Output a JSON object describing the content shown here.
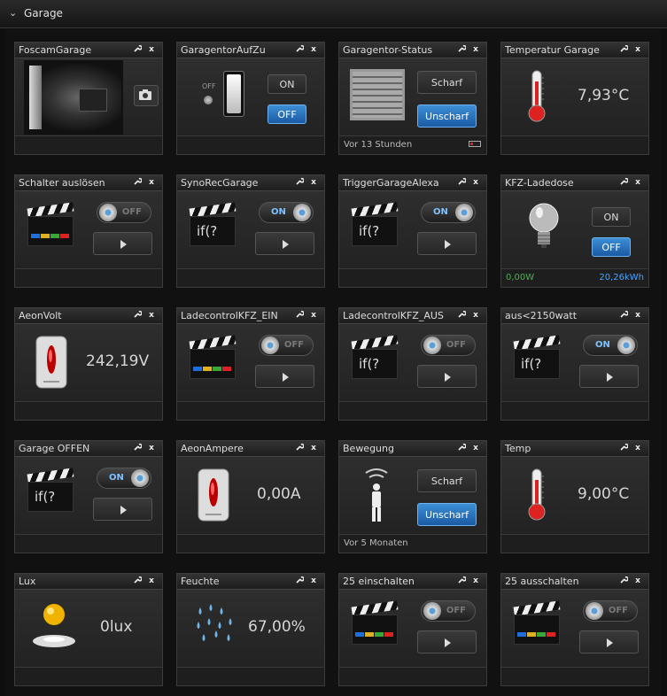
{
  "section": {
    "chevron": "⌄",
    "title": "Garage"
  },
  "icons": {
    "tool": "wrench-icon",
    "close": "close-icon"
  },
  "close_glyph": "x",
  "colors": {
    "blue_button": "#1a5aa3",
    "on_text": "#7fc1ff",
    "power_green": "#4caf50",
    "energy_blue": "#4aa3ff"
  },
  "widgets": [
    {
      "title": "FoscamGarage",
      "type": "camera"
    },
    {
      "title": "GaragentorAufZu",
      "type": "switch",
      "switch_label": "OFF",
      "on_label": "ON",
      "off_label": "OFF",
      "active": "off"
    },
    {
      "title": "Garagentor-Status",
      "type": "alarm",
      "arm_label": "Scharf",
      "disarm_label": "Unscharf",
      "active": "disarm",
      "footer": "Vor 13 Stunden"
    },
    {
      "title": "Temperatur Garage",
      "type": "temperature",
      "value": "7,93°C"
    },
    {
      "title": "Schalter auslösen",
      "type": "scene",
      "toggle": "OFF",
      "variant": "bars"
    },
    {
      "title": "SynoRecGarage",
      "type": "scene",
      "toggle": "ON",
      "variant": "if",
      "if_text": "if(?"
    },
    {
      "title": "TriggerGarageAlexa",
      "type": "scene",
      "toggle": "ON",
      "variant": "if",
      "if_text": "if(?"
    },
    {
      "title": "KFZ-Ladedose",
      "type": "plug",
      "on_label": "ON",
      "off_label": "OFF",
      "active": "off",
      "power": "0,00W",
      "energy": "20,26kWh"
    },
    {
      "title": "AeonVolt",
      "type": "meter",
      "value": "242,19V"
    },
    {
      "title": "LadecontrolKFZ_EIN",
      "type": "scene",
      "toggle": "OFF",
      "variant": "bars"
    },
    {
      "title": "LadecontrolKFZ_AUS",
      "type": "scene",
      "toggle": "OFF",
      "variant": "if",
      "if_text": "if(?"
    },
    {
      "title": "aus<2150watt",
      "type": "scene",
      "toggle": "ON",
      "variant": "if",
      "if_text": "if(?"
    },
    {
      "title": "Garage OFFEN",
      "type": "scene",
      "toggle": "ON",
      "variant": "if",
      "if_text": "if(?"
    },
    {
      "title": "AeonAmpere",
      "type": "meter",
      "value": "0,00A"
    },
    {
      "title": "Bewegung",
      "type": "motion",
      "arm_label": "Scharf",
      "disarm_label": "Unscharf",
      "active": "disarm",
      "footer": "Vor 5 Monaten"
    },
    {
      "title": "Temp",
      "type": "temperature",
      "value": "9,00°C"
    },
    {
      "title": "Lux",
      "type": "lux",
      "value": "0lux"
    },
    {
      "title": "Feuchte",
      "type": "humidity",
      "value": "67,00%"
    },
    {
      "title": "25 einschalten",
      "type": "scene",
      "toggle": "OFF",
      "variant": "bars"
    },
    {
      "title": "25 ausschalten",
      "type": "scene",
      "toggle": "OFF",
      "variant": "bars"
    }
  ]
}
